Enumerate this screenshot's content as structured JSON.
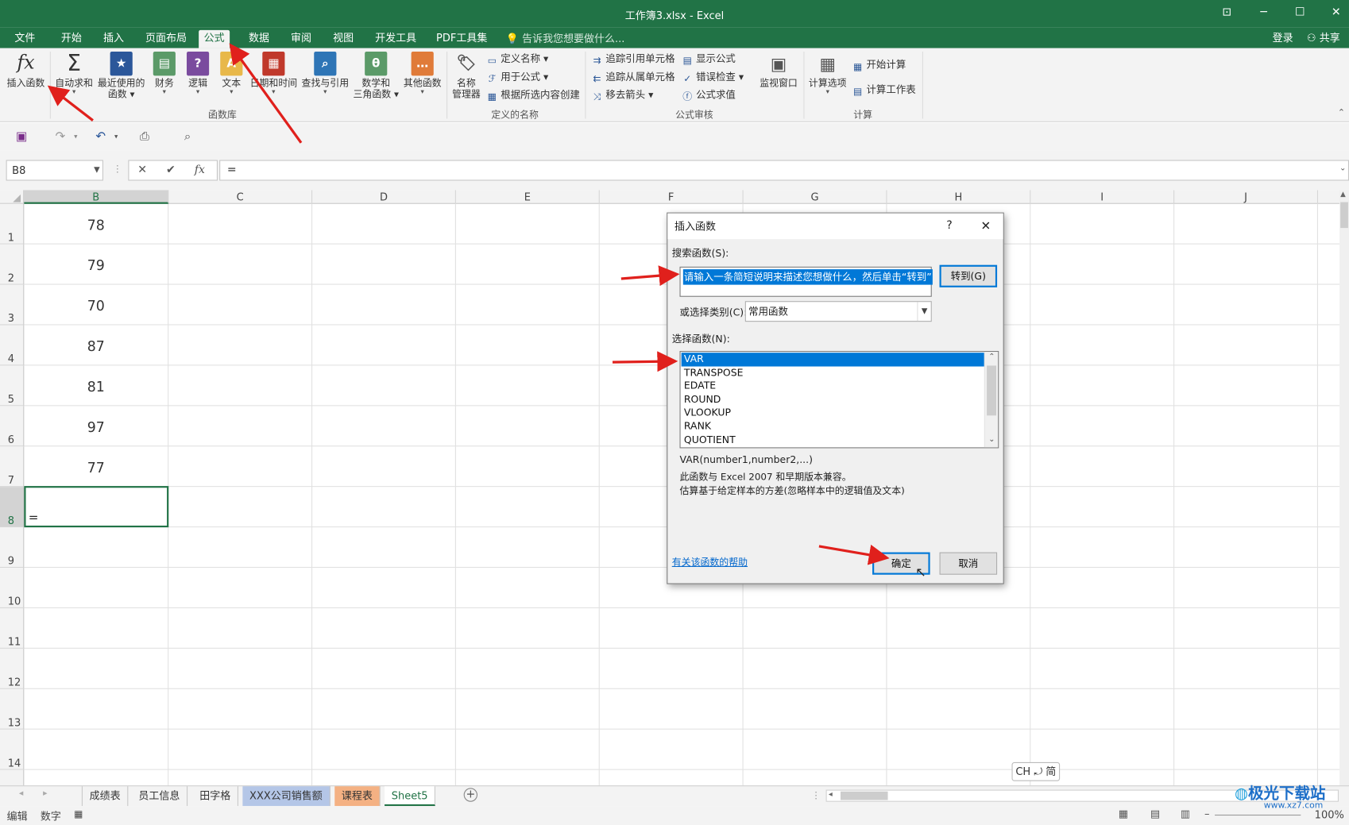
{
  "window": {
    "title": "工作簿3.xlsx - Excel"
  },
  "tabs": [
    "文件",
    "开始",
    "插入",
    "页面布局",
    "公式",
    "数据",
    "审阅",
    "视图",
    "开发工具",
    "PDF工具集"
  ],
  "active_tab": "公式",
  "tell_me": "告诉我您想要做什么...",
  "account": {
    "login": "登录",
    "share": "共享"
  },
  "ribbon": {
    "insert_function": "插入函数",
    "autosum": "自动求和",
    "recent": "最近使用的\n函数",
    "financial": "财务",
    "logical": "逻辑",
    "text": "文本",
    "datetime": "日期和时间",
    "lookup": "查找与引用",
    "math": "数学和\n三角函数",
    "more": "其他函数",
    "group_library": "函数库",
    "name_manager": "名称\n管理器",
    "define_name": "定义名称",
    "use_in_formula": "用于公式",
    "create_from_selection": "根据所选内容创建",
    "group_names": "定义的名称",
    "trace_precedents": "追踪引用单元格",
    "trace_dependents": "追踪从属单元格",
    "remove_arrows": "移去箭头",
    "show_formulas": "显示公式",
    "error_checking": "错误检查",
    "evaluate_formula": "公式求值",
    "watch_window": "监视窗口",
    "group_audit": "公式审核",
    "calc_options": "计算选项",
    "calc_now": "开始计算",
    "calc_sheet": "计算工作表",
    "group_calc": "计算"
  },
  "formula_bar": {
    "name_box": "B8",
    "formula": "="
  },
  "columns": [
    "B",
    "C",
    "D",
    "E",
    "F",
    "G",
    "H",
    "I",
    "J"
  ],
  "rows": [
    "1",
    "2",
    "3",
    "4",
    "5",
    "6",
    "7",
    "8",
    "9",
    "10",
    "11",
    "12",
    "13",
    "14"
  ],
  "cells_b": [
    "78",
    "79",
    "70",
    "87",
    "81",
    "97",
    "77"
  ],
  "active_cell_value": "=",
  "dialog": {
    "title": "插入函数",
    "help_q": "?",
    "search_label": "搜索函数(S):",
    "search_value": "请输入一条简短说明来描述您想做什么，然后单击“转到”",
    "go_button": "转到(G)",
    "category_label": "或选择类别(C):",
    "category_value": "常用函数",
    "select_label": "选择函数(N):",
    "functions": [
      "VAR",
      "TRANSPOSE",
      "EDATE",
      "ROUND",
      "VLOOKUP",
      "RANK",
      "QUOTIENT"
    ],
    "signature": "VAR(number1,number2,...)",
    "desc1": "此函数与 Excel 2007 和早期版本兼容。",
    "desc2": "估算基于给定样本的方差(忽略样本中的逻辑值及文本)",
    "help_link": "有关该函数的帮助",
    "ok": "确定",
    "cancel": "取消"
  },
  "sheets": [
    "成绩表",
    "员工信息",
    "田字格",
    "XXX公司销售额",
    "课程表",
    "Sheet5"
  ],
  "active_sheet": "Sheet5",
  "status": {
    "mode": "编辑",
    "num": "数字",
    "zoom": "100%"
  },
  "ime": "CH ⤾ 简",
  "watermark": "极光下载站",
  "watermark_url": "www.xz7.com",
  "colors": {
    "excel_green": "#217346",
    "selection_blue": "#0078d7",
    "arrow_red": "#e0201c"
  }
}
